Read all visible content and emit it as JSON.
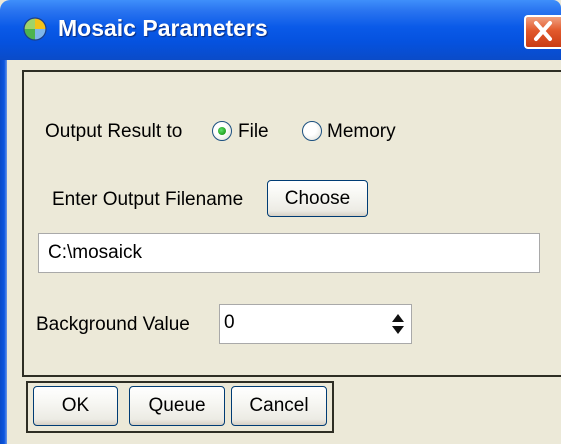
{
  "window": {
    "title": "Mosaic Parameters"
  },
  "output": {
    "label": "Output Result to",
    "options": [
      {
        "label": "File",
        "selected": true
      },
      {
        "label": "Memory",
        "selected": false
      }
    ]
  },
  "filename": {
    "label": "Enter Output Filename",
    "choose_label": "Choose",
    "value": "C:\\mosaick"
  },
  "background": {
    "label": "Background Value",
    "value": "0"
  },
  "buttons": {
    "ok": "OK",
    "queue": "Queue",
    "cancel": "Cancel"
  },
  "colors": {
    "titlebar": "#0a5ae8",
    "close": "#e2592c",
    "dialog_bg": "#ece9d8",
    "radio_selected": "#21a121"
  }
}
